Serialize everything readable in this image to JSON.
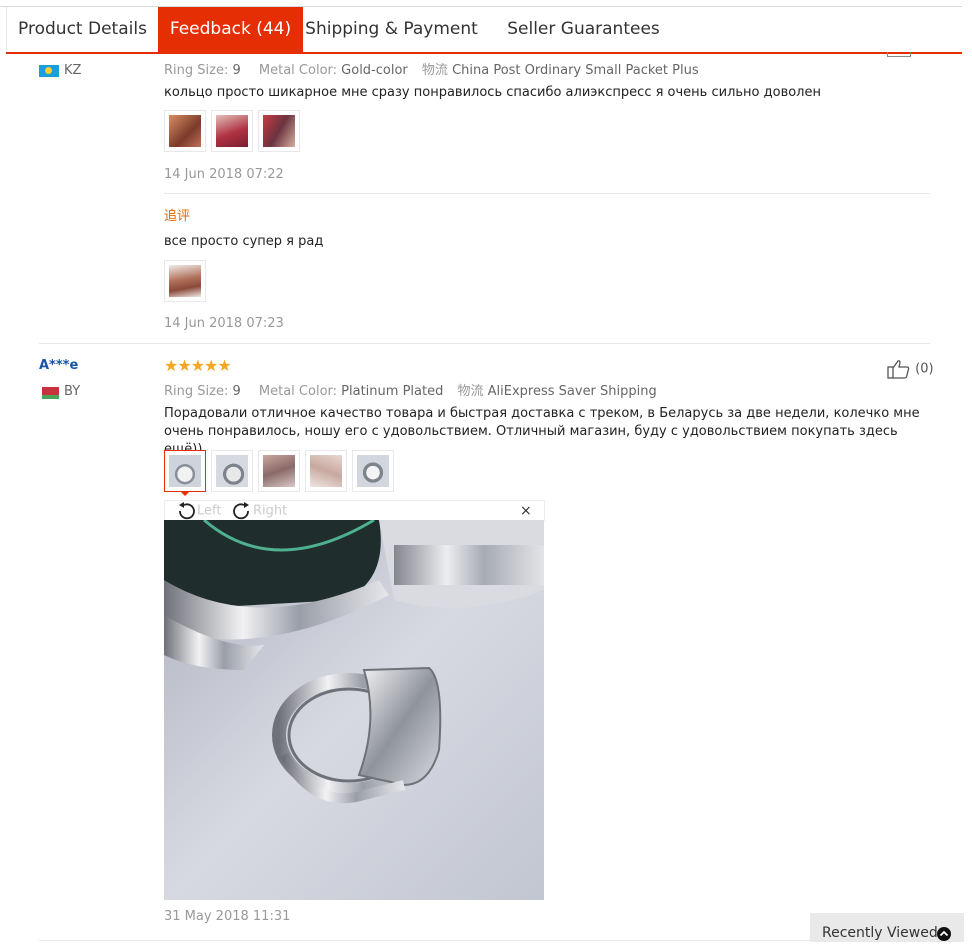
{
  "tabs": [
    {
      "label": "Product Details"
    },
    {
      "label": "Feedback (44)"
    },
    {
      "label": "Shipping & Payment"
    },
    {
      "label": "Seller Guarantees"
    }
  ],
  "active_tab": 1,
  "review1": {
    "country": "KZ",
    "attrs": {
      "ring_label": "Ring Size:",
      "ring_value": "9",
      "metal_label": "Metal Color:",
      "metal_value": "Gold-color",
      "ship_label": "物流",
      "ship_value": "China Post Ordinary Small Packet Plus"
    },
    "text": "кольцо просто шикарное мне сразу понравилось спасибо алиэкспресс я очень сильно доволен",
    "date": "14 Jun 2018 07:22",
    "followup_label": "追评",
    "followup_text": "все просто супер я рад",
    "followup_date": "14 Jun 2018 07:23"
  },
  "review2": {
    "username": "A***e",
    "country": "BY",
    "stars": "★★★★★",
    "likes": "(0)",
    "attrs": {
      "ring_label": "Ring Size:",
      "ring_value": "9",
      "metal_label": "Metal Color:",
      "metal_value": "Platinum Plated",
      "ship_label": "物流",
      "ship_value": "AliExpress Saver Shipping"
    },
    "text": "Порадовали отличное качество товара и быстрая доставка с треком, в Беларусь за две недели, колечко мне очень понравилось, ношу его с удовольствием. Отличный магазин, буду с удовольствием покупать здесь ещё))",
    "date": "31 May 2018 11:31"
  },
  "viewer": {
    "rotate_left": "Left",
    "rotate_right": "Right",
    "close": "×"
  },
  "recently_viewed": "Recently Viewed",
  "colors": {
    "accent": "#e62e04",
    "link": "#1a55a6",
    "star": "#f5a623",
    "followup": "#e56600"
  },
  "icons": {
    "like": "thumbs-up-icon",
    "rotate_left": "rotate-left-icon",
    "rotate_right": "rotate-right-icon",
    "close": "close-icon",
    "recent": "chevron-up-icon"
  }
}
